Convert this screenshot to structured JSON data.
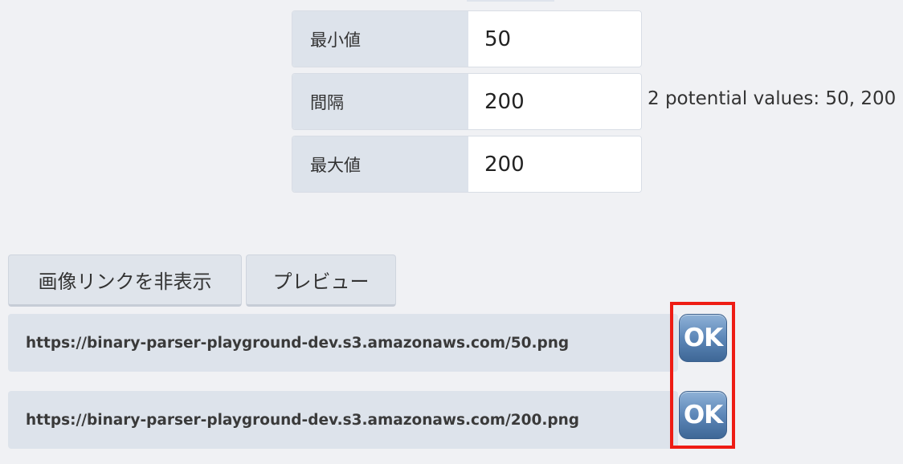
{
  "range": {
    "min": {
      "label": "最小値",
      "value": "50"
    },
    "step": {
      "label": "間隔",
      "value": "200"
    },
    "max": {
      "label": "最大値",
      "value": "200"
    },
    "hint": "2 potential values: 50, 200"
  },
  "buttons": {
    "hide_links": "画像リンクを非表示",
    "preview": "プレビュー"
  },
  "links": [
    {
      "url": "https://binary-parser-playground-dev.s3.amazonaws.com/50.png",
      "status_icon": "ok-icon",
      "status": "OK"
    },
    {
      "url": "https://binary-parser-playground-dev.s3.amazonaws.com/200.png",
      "status_icon": "ok-icon",
      "status": "OK"
    }
  ],
  "colors": {
    "highlight": "#ee1c14",
    "ok_icon": "#5d87b8",
    "row_label_bg": "#dde3eb"
  }
}
